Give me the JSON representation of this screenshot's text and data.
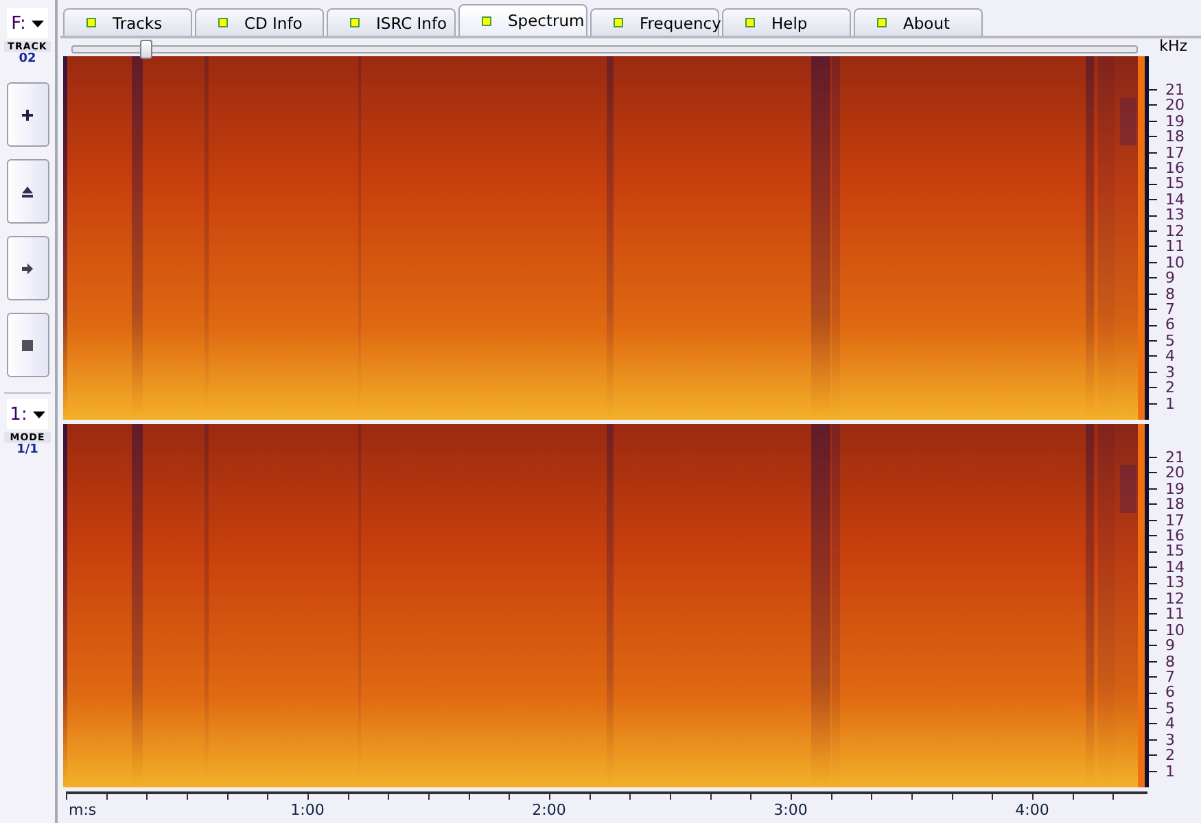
{
  "sidebar": {
    "drive": {
      "value": "F:"
    },
    "track": {
      "label": "TRACK",
      "value": "02"
    },
    "buttons": [
      {
        "kind": "plus"
      },
      {
        "kind": "eject"
      },
      {
        "kind": "next"
      },
      {
        "kind": "stop"
      }
    ],
    "mode": {
      "value": "1:",
      "label": "MODE",
      "reading": "1/1"
    }
  },
  "tabs": [
    {
      "label": "Tracks",
      "selected": false
    },
    {
      "label": "CD Info",
      "selected": false
    },
    {
      "label": "ISRC Info",
      "selected": false
    },
    {
      "label": "Spectrum",
      "selected": true
    },
    {
      "label": "Frequency",
      "selected": false
    },
    {
      "label": "Help",
      "selected": false
    },
    {
      "label": "About",
      "selected": false
    }
  ],
  "position_slider": {
    "level": 0.068
  },
  "frequency_axis": {
    "unit": "kHz"
  },
  "channels": [
    {
      "kind": "spectrogram",
      "frequency_labels": [
        "21",
        "20",
        "19",
        "18",
        "17",
        "16",
        "15",
        "14",
        "13",
        "12",
        "11",
        "10",
        "9",
        "8",
        "7",
        "6",
        "5",
        "4",
        "3",
        "2",
        "1"
      ]
    },
    {
      "kind": "spectrogram",
      "frequency_labels": [
        "21",
        "20",
        "19",
        "18",
        "17",
        "16",
        "15",
        "14",
        "13",
        "12",
        "11",
        "10",
        "9",
        "8",
        "7",
        "6",
        "5",
        "4",
        "3",
        "2",
        "1"
      ]
    }
  ],
  "time_axis": {
    "unit": "m:s",
    "labels": [
      "1:00",
      "2:00",
      "3:00",
      "4:00"
    ]
  }
}
